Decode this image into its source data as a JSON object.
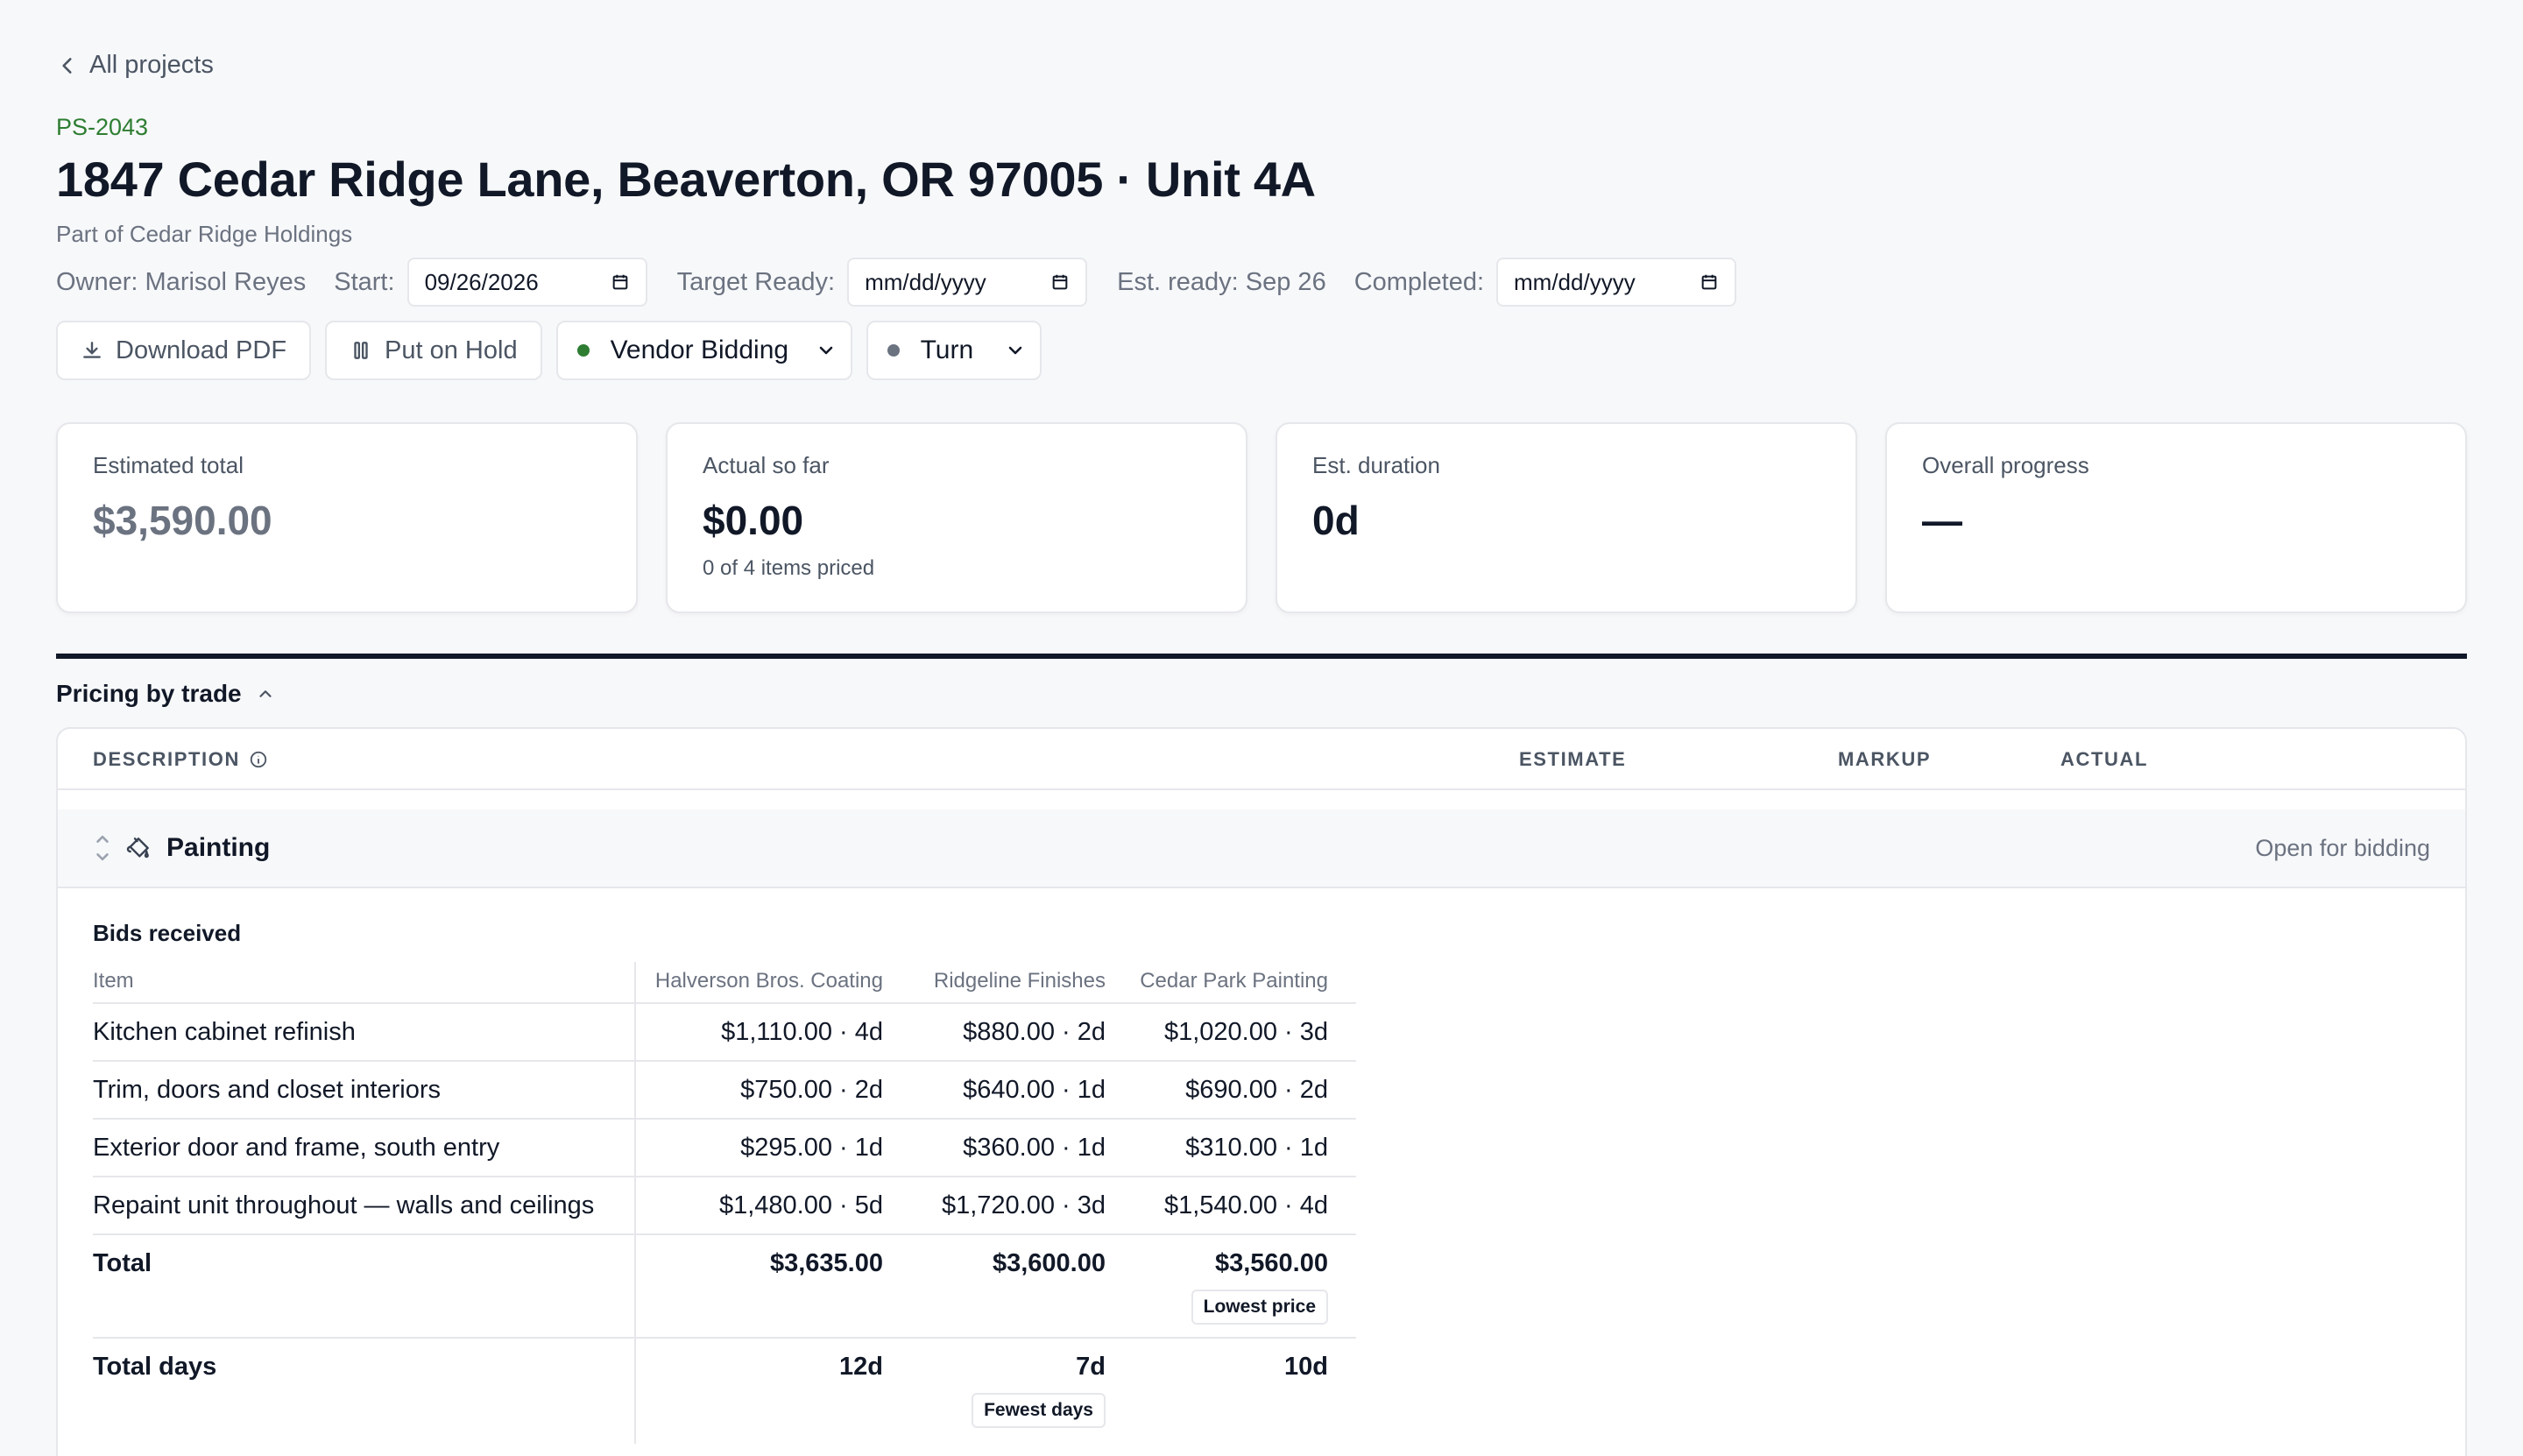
{
  "nav": {
    "back_label": "All projects"
  },
  "project": {
    "id": "PS-2043",
    "title": "1847 Cedar Ridge Lane, Beaverton, OR 97005 · Unit 4A",
    "subtitle": "Part of Cedar Ridge Holdings"
  },
  "meta": {
    "owner": "Owner: Marisol Reyes",
    "start_label": "Start:",
    "start_value": "09/26/2026",
    "target_label": "Target Ready:",
    "target_value": "mm/dd/yyyy",
    "est_ready": "Est. ready: Sep 26",
    "completed_label": "Completed:",
    "completed_value": "mm/dd/yyyy"
  },
  "actions": {
    "download_label": "Download PDF",
    "hold_label": "Put on Hold",
    "status_select": {
      "value": "Vendor Bidding",
      "dot_color": "#2e7d32"
    },
    "type_select": {
      "value": "Turn",
      "dot_color": "#6b7280"
    }
  },
  "cards": [
    {
      "label": "Estimated total",
      "value": "$3,590.00",
      "sub": ""
    },
    {
      "label": "Actual so far",
      "value": "$0.00",
      "sub": "0 of 4 items priced"
    },
    {
      "label": "Est. duration",
      "value": "0d",
      "sub": ""
    },
    {
      "label": "Overall progress",
      "value": "—",
      "sub": ""
    }
  ],
  "section": {
    "title": "Pricing by trade"
  },
  "table": {
    "columns": {
      "description": "DESCRIPTION",
      "estimate": "ESTIMATE",
      "markup": "MARKUP",
      "actual": "ACTUAL"
    },
    "trade": {
      "name": "Painting",
      "status": "Open for bidding"
    },
    "bids": {
      "title": "Bids received",
      "header": [
        "Item",
        "Halverson Bros. Coating",
        "Ridgeline Finishes",
        "Cedar Park Painting"
      ],
      "rows": [
        {
          "item": "Kitchen cabinet refinish",
          "v1": "$1,110.00 · 4d",
          "v2": "$880.00 · 2d",
          "v3": "$1,020.00 · 3d"
        },
        {
          "item": "Trim, doors and closet interiors",
          "v1": "$750.00 · 2d",
          "v2": "$640.00 · 1d",
          "v3": "$690.00 · 2d"
        },
        {
          "item": "Exterior door and frame, south entry",
          "v1": "$295.00 · 1d",
          "v2": "$360.00 · 1d",
          "v3": "$310.00 · 1d"
        },
        {
          "item": "Repaint unit throughout — walls and ceilings",
          "v1": "$1,480.00 · 5d",
          "v2": "$1,720.00 · 3d",
          "v3": "$1,540.00 · 4d"
        }
      ],
      "total": {
        "label": "Total",
        "v1": "$3,635.00",
        "v2": "$3,600.00",
        "v3": "$3,560.00",
        "badge": "Lowest price"
      },
      "days": {
        "label": "Total days",
        "v1": "12d",
        "v2": "7d",
        "v3": "10d",
        "badge": "Fewest days"
      }
    }
  }
}
